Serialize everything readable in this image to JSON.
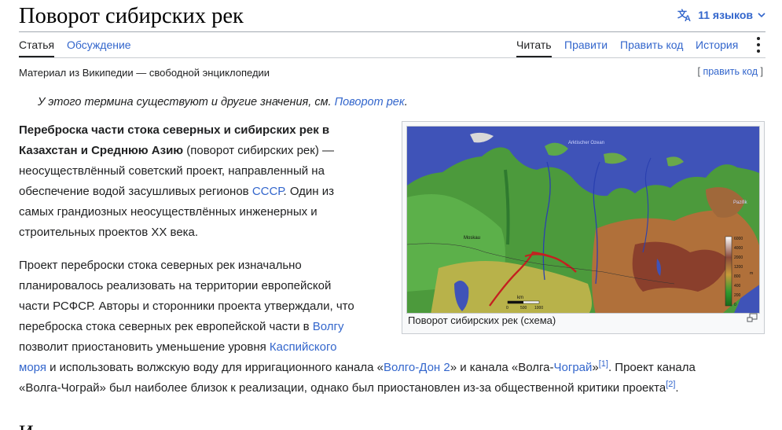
{
  "header": {
    "title": "Поворот сибирских рек",
    "languages_label": "11 языков"
  },
  "tabs": {
    "article": "Статья",
    "talk": "Обсуждение",
    "read": "Читать",
    "edit": "Правити",
    "edit_source": "Править код",
    "history": "История"
  },
  "tagline": "Материал из Википедии — свободной энциклопедии",
  "edit_section": {
    "open": "[ ",
    "link": "править код",
    "close": " ]"
  },
  "hatnote": {
    "text": "У этого термина существуют и другие значения, см. ",
    "link": "Поворот рек",
    "end": "."
  },
  "paragraph1": {
    "bold": "Переброска части стока северных и сибирских рек в",
    "bold2": "Казахстан и Среднюю Азию",
    "t1": " (поворот сибирских рек) —",
    "t2": "неосуществлённый советский проект, направленный на",
    "t3": "обеспечение водой засушливых регионов ",
    "link_ussr": "СССР",
    "t4": ". Один из",
    "t5": "самых грандиозных неосуществлённых инженерных и",
    "t6": "строительных проектов XX века."
  },
  "paragraph2": {
    "l1": "Проект переброски стока северных рек изначально",
    "l2": "планировалось реализовать на территории европейской",
    "l3": "части РСФСР. Авторы и сторонники проекта утверждали, что",
    "l4a": "переброска стока северных рек европейской части в ",
    "link_volga": "Волгу",
    "l5": "позволит приостановить уменьшение уровня ",
    "link_caspian1": "Каспийского",
    "link_caspian2": "моря",
    "l6a": " и использовать волжскую воду для ирригационного канала «",
    "link_volgodon": "Волго-Дон 2",
    "l6b": "» и канала «Волга-",
    "link_chograi": "Чограй",
    "l6c": "»",
    "ref1": "[1]",
    "l6d": ". Проект канала",
    "l7a": "«Волга-Чограй» был наиболее близок к реализации, однако был приостановлен из-за общественной критики проекта",
    "ref2": "[2]",
    "l7b": "."
  },
  "figure": {
    "caption": "Поворот сибирских рек (схема)",
    "map_labels": {
      "ocean": "Arktischer Ozean",
      "pazifik": "Pazifik",
      "moskau": "Moskau"
    },
    "legend_ticks": [
      "6000",
      "4000",
      "2000",
      "1200",
      "800",
      "400",
      "200",
      "0"
    ],
    "legend_unit": "m",
    "scale_label": "km",
    "scale_ticks": [
      "0",
      "500",
      "1000"
    ]
  },
  "next_heading": "И"
}
